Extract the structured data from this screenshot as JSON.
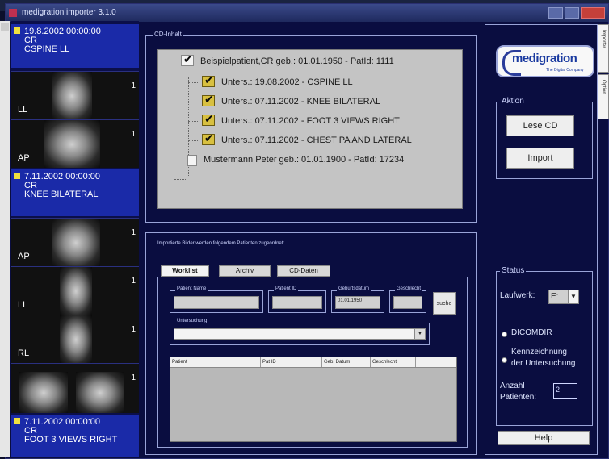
{
  "window": {
    "title": "medigration importer 3.1.0"
  },
  "sidebar_tabs": [
    {
      "label": "Importer"
    },
    {
      "label": "Option"
    }
  ],
  "studies": [
    {
      "date": "19.8.2002 00:00:00",
      "modality": "CR",
      "description": "CSPINE LL",
      "images": [
        {
          "label": "LL",
          "count": "1"
        },
        {
          "label": "AP",
          "count": "1"
        }
      ]
    },
    {
      "date": "7.11.2002 00:00:00",
      "modality": "CR",
      "description": "KNEE BILATERAL",
      "images": [
        {
          "label": "AP",
          "count": "1"
        },
        {
          "label": "LL",
          "count": "1"
        },
        {
          "label": "RL",
          "count": "1"
        },
        {
          "label": "",
          "count": "1"
        }
      ]
    },
    {
      "date": "7.11.2002 00:00:00",
      "modality": "CR",
      "description": "FOOT 3 VIEWS RIGHT"
    }
  ],
  "cd_inhalt": {
    "legend": "CD-Inhalt",
    "patients": [
      {
        "label": "Beispielpatient,CR  geb.: 01.01.1950  - PatId: 1111",
        "checked": true,
        "exams": [
          {
            "label": "Unters.: 19.08.2002 - CSPINE  LL"
          },
          {
            "label": "Unters.: 07.11.2002 - KNEE BILATERAL"
          },
          {
            "label": "Unters.: 07.11.2002 - FOOT 3 VIEWS RIGHT"
          },
          {
            "label": "Unters.: 07.11.2002 - CHEST PA AND LATERAL"
          }
        ]
      },
      {
        "label": "Mustermann Peter  geb.: 01.01.1900  - PatId: 17234",
        "checked": false,
        "exams": []
      }
    ]
  },
  "import_section": {
    "caption": "Importierte Bilder werden folgendem Patienten zugeordnet:",
    "tabs": [
      {
        "label": "Worklist",
        "active": true
      },
      {
        "label": "Archiv",
        "active": false
      },
      {
        "label": "CD-Daten",
        "active": false
      }
    ],
    "fields": {
      "patient_name_label": "Patient Name",
      "patient_id_label": "Patient ID",
      "geburtsdatum_label": "Geburtsdatum",
      "geburtsdatum_value": "01.01.1950",
      "geschlecht_label": "Geschlecht",
      "suche_label": "suche",
      "untersuchung_label": "Untersuchung"
    },
    "grid_columns": [
      "Patient",
      "Pat ID",
      "Geb. Datum",
      "Geschlecht"
    ]
  },
  "aktion": {
    "legend": "Aktion",
    "lese_cd": "Lese CD",
    "import": "Import"
  },
  "status": {
    "legend": "Status",
    "laufwerk_label": "Laufwerk:",
    "laufwerk_value": "E:",
    "option_dicomdir": "DICOMDIR",
    "option_kennzeichnung_line1": "Kennzeichnung",
    "option_kennzeichnung_line2": "der Untersuchung",
    "anzahl_line1": "Anzahl",
    "anzahl_line2": "Patienten:",
    "anzahl_value": "2"
  },
  "help_label": "Help",
  "logo": {
    "name": "medigration",
    "tagline": "The Digital Company"
  },
  "colors": {
    "window_bg": "#0a0d40",
    "study_header": "#1a2aa8",
    "check_yellow": "#d8c040"
  }
}
